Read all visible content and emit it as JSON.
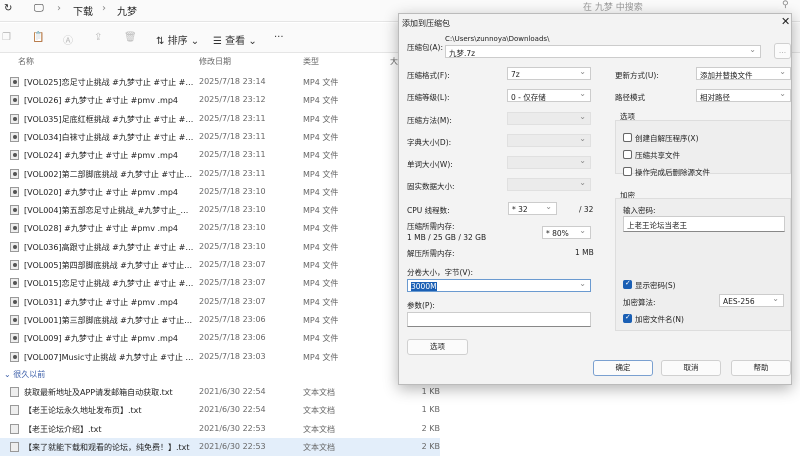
{
  "breadcrumb": {
    "items": [
      "下载",
      "九梦"
    ]
  },
  "search": {
    "placeholder": "在 九梦 中搜索"
  },
  "toolbar": {
    "sort": "排序",
    "view": "查看",
    "more": "···"
  },
  "columns": {
    "name": "名称",
    "date": "修改日期",
    "type": "类型",
    "size": "大"
  },
  "files": [
    {
      "name": "[VOL025]恋足寸止挑战 #九梦寸止 #寸止 #pm...",
      "date": "2025/7/18 23:14",
      "type": "MP4 文件"
    },
    {
      "name": "[VOL026] #九梦寸止 #寸止 #pmv .mp4",
      "date": "2025/7/18 23:12",
      "type": "MP4 文件"
    },
    {
      "name": "[VOL035]足底红框挑战 #九梦寸止 #寸止 #pm...",
      "date": "2025/7/18 23:11",
      "type": "MP4 文件"
    },
    {
      "name": "[VOL034]白袜寸止挑战 #九梦寸止 #寸止 #pm...",
      "date": "2025/7/18 23:11",
      "type": "MP4 文件"
    },
    {
      "name": "[VOL024] #九梦寸止 #寸止 #pmv .mp4",
      "date": "2025/7/18 23:11",
      "type": "MP4 文件"
    },
    {
      "name": "[VOL002]第二部脚底挑战 #九梦寸止 #寸止 #...",
      "date": "2025/7/18 23:11",
      "type": "MP4 文件"
    },
    {
      "name": "[VOL020] #九梦寸止 #寸止 #pmv .mp4",
      "date": "2025/7/18 23:10",
      "type": "MP4 文件"
    },
    {
      "name": "[VOL004]第五部恋足寸止挑战_#九梦寸止_#寸...",
      "date": "2025/7/18 23:10",
      "type": "MP4 文件"
    },
    {
      "name": "[VOL028] #九梦寸止 #寸止 #pmv .mp4",
      "date": "2025/7/18 23:10",
      "type": "MP4 文件"
    },
    {
      "name": "[VOL036]高跟寸止挑战 #九梦寸止 #寸止 #pm...",
      "date": "2025/7/18 23:10",
      "type": "MP4 文件"
    },
    {
      "name": "[VOL005]第四部脚底挑战 #九梦寸止 #寸止 #...",
      "date": "2025/7/18 23:07",
      "type": "MP4 文件"
    },
    {
      "name": "[VOL015]恋足寸止挑战 #九梦寸止 #寸止 #pm...",
      "date": "2025/7/18 23:07",
      "type": "MP4 文件"
    },
    {
      "name": "[VOL031] #九梦寸止 #寸止 #pmv .mp4",
      "date": "2025/7/18 23:07",
      "type": "MP4 文件"
    },
    {
      "name": "[VOL001]第三部脚底挑战 #九梦寸止 #寸止 #...",
      "date": "2025/7/18 23:06",
      "type": "MP4 文件"
    },
    {
      "name": "[VOL009] #九梦寸止 #寸止 #pmv .mp4",
      "date": "2025/7/18 23:06",
      "type": "MP4 文件"
    },
    {
      "name": "[VOL007]Music寸止挑战 #九梦寸止 #寸止 #p...",
      "date": "2025/7/18 23:03",
      "type": "MP4 文件"
    }
  ],
  "group_label": "很久以前",
  "old_files": [
    {
      "name": "获取最新地址及APP请发邮箱自动获取.txt",
      "date": "2021/6/30 22:54",
      "type": "文本文档",
      "size": "1 KB"
    },
    {
      "name": "【老王论坛永久地址发布页】.txt",
      "date": "2021/6/30 22:54",
      "type": "文本文档",
      "size": "1 KB"
    },
    {
      "name": "【老王论坛介绍】.txt",
      "date": "2021/6/30 22:53",
      "type": "文本文档",
      "size": "2 KB"
    },
    {
      "name": "【来了就能下载和观看的论坛，纯免费！】.txt",
      "date": "2021/6/30 22:53",
      "type": "文本文档",
      "size": "2 KB"
    }
  ],
  "dialog": {
    "title": "添加到压缩包",
    "archive_label": "压缩包(A):",
    "archive_dir": "C:\\Users\\zunnoya\\Downloads\\",
    "archive_name": "九梦.7z",
    "browse": "...",
    "format_label": "压缩格式(F):",
    "format": "7z",
    "level_label": "压缩等级(L):",
    "level": "0 - 仅存储",
    "method_label": "压缩方法(M):",
    "dict_label": "字典大小(D):",
    "word_label": "单词大小(W):",
    "solid_label": "固实数据大小:",
    "cpu_label": "CPU 线程数:",
    "cpu": "* 32",
    "cpu_max": "/ 32",
    "mem_label": "压缩所需内存:",
    "mem_values": "1 MB / 25 GB / 32 GB",
    "mem": "* 80%",
    "decomp_label": "解压所需内存:",
    "decomp": "1 MB",
    "split_label": "分卷大小，字节(V):",
    "split": "3000M",
    "params_label": "参数(P):",
    "params": "",
    "options_btn": "选项",
    "update_label": "更新方式(U):",
    "update": "添加并替换文件",
    "path_label": "路径模式",
    "path": "相对路径",
    "opts_title": "选项",
    "opt_sfx": "创建自解压程序(X)",
    "opt_shared": "压缩共享文件",
    "opt_delete": "操作完成后删除源文件",
    "enc_title": "加密",
    "pwd_label": "输入密码:",
    "pwd": "上老王论坛当老王",
    "show_pwd": "显示密码(S)",
    "show_pwd_checked": true,
    "enc_method_label": "加密算法:",
    "enc_method": "AES-256",
    "enc_names": "加密文件名(N)",
    "enc_names_checked": true,
    "ok": "确定",
    "cancel": "取消",
    "help": "帮助"
  }
}
